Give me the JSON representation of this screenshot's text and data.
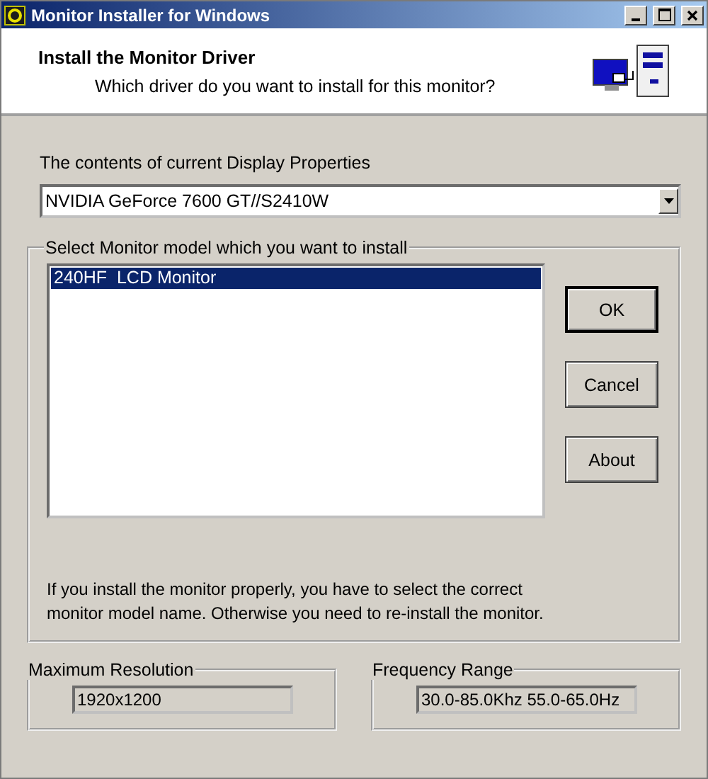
{
  "window": {
    "title": "Monitor Installer for Windows"
  },
  "header": {
    "title": "Install the Monitor Driver",
    "subtitle": "Which driver do you want to install for this monitor?"
  },
  "display": {
    "label": "The contents of current Display Properties",
    "value": "NVIDIA GeForce 7600 GT//S2410W"
  },
  "model_group": {
    "title": "Select Monitor model which you want to install",
    "items": [
      {
        "label": "240HF  LCD Monitor",
        "selected": true
      }
    ],
    "note": "If you install the monitor properly, you have to select the correct monitor model name. Otherwise you need to re-install the monitor."
  },
  "buttons": [
    {
      "label": "OK",
      "focused": true
    },
    {
      "label": "Cancel",
      "focused": false
    },
    {
      "label": "About",
      "focused": false
    }
  ],
  "max_resolution": {
    "title": "Maximum Resolution",
    "value": "1920x1200"
  },
  "frequency_range": {
    "title": "Frequency Range",
    "value": "30.0-85.0Khz 55.0-65.0Hz"
  }
}
